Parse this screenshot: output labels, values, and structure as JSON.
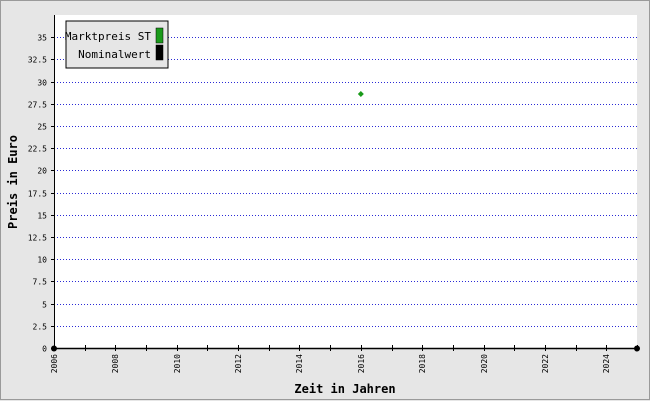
{
  "chart_data": {
    "type": "scatter",
    "title": "",
    "xlabel": "Zeit in Jahren",
    "ylabel": "Preis in Euro",
    "xlim": [
      2006,
      2025
    ],
    "ylim": [
      0,
      37.5
    ],
    "x_ticks": [
      "2006",
      "2008",
      "2010",
      "2012",
      "2014",
      "2016",
      "2018",
      "2020",
      "2022",
      "2024"
    ],
    "y_ticks": [
      "0",
      "2.5",
      "5",
      "7.5",
      "10",
      "12.5",
      "15",
      "17.5",
      "20",
      "22.5",
      "25",
      "27.5",
      "30",
      "32.5",
      "35"
    ],
    "grid": "horizontal dotted",
    "legend_position": "top-left",
    "series": [
      {
        "name": "Marktpreis ST",
        "color": "#1a9a1a",
        "points": [
          {
            "x": 2016,
            "y": 28.6
          }
        ]
      },
      {
        "name": "Nominalwert",
        "color": "#000000",
        "points": []
      }
    ]
  }
}
